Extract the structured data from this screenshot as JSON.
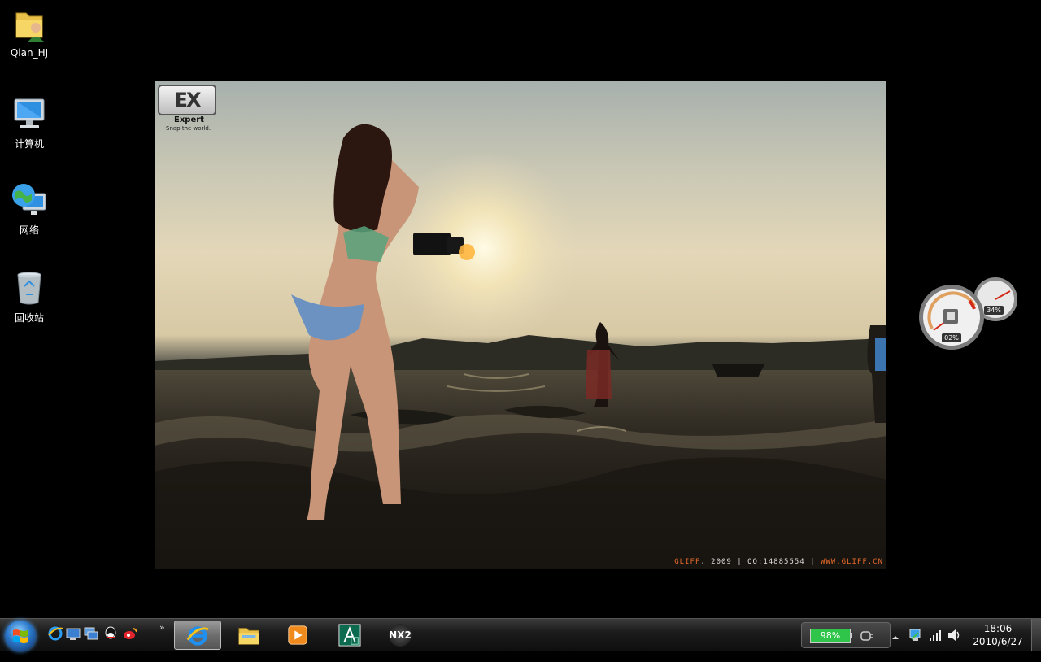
{
  "desktop": {
    "icons": [
      {
        "label": "Qian_HJ",
        "icon": "user-folder-icon"
      },
      {
        "label": "计算机",
        "icon": "computer-icon"
      },
      {
        "label": "网络",
        "icon": "network-icon"
      },
      {
        "label": "回收站",
        "icon": "recycle-bin-icon"
      }
    ]
  },
  "wallpaper": {
    "logo_text": "EX",
    "logo_title": "Expert",
    "logo_tagline": "Snap the world.",
    "credit_brand": "GLIFF",
    "credit_year": ", 2009",
    "credit_sep": " | ",
    "credit_qq": "QQ:14885554",
    "credit_site": "WWW.GLIFF.CN"
  },
  "gadget": {
    "cpu_label": "02%",
    "memory_label": "34%"
  },
  "taskbar": {
    "quick_launch": [
      "ie-icon",
      "show-desktop-icon",
      "switch-windows-icon",
      "qq-icon",
      "weibo-icon"
    ],
    "overflow": "»",
    "apps": [
      "internet-explorer-icon",
      "file-explorer-icon",
      "media-player-icon",
      "autocad-icon",
      "nx2-icon"
    ],
    "nx2_label": "NX2",
    "battery_percent": "98%",
    "time": "18:06",
    "date": "2010/6/27"
  },
  "colors": {
    "accent": "#2a76c8",
    "battery_green": "#2fc44a",
    "credit_orange": "#e86a2a"
  }
}
